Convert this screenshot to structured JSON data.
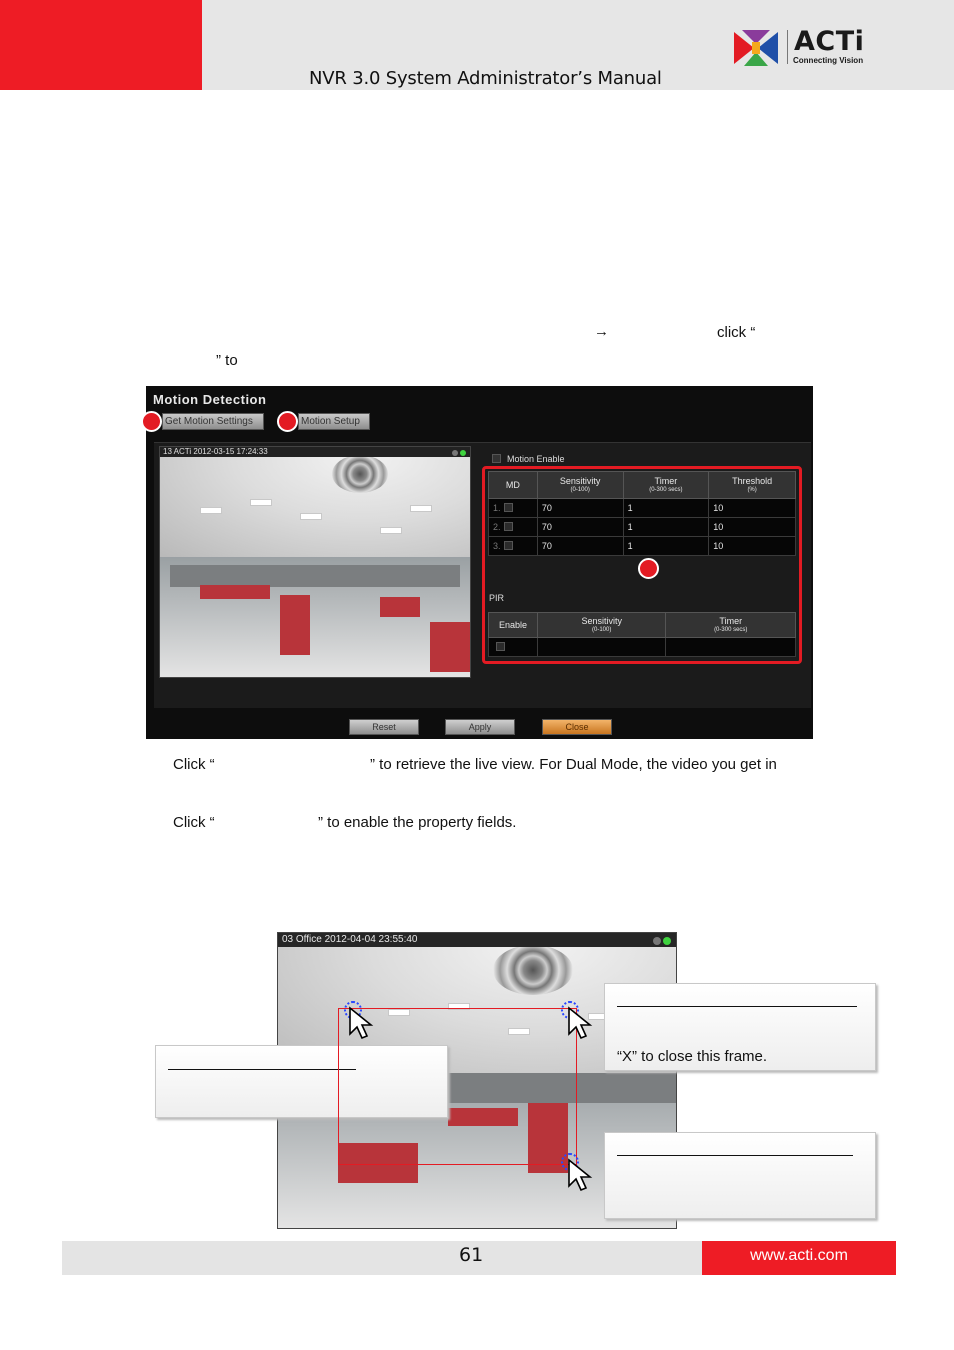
{
  "header": {
    "manual_title": "NVR 3.0 System Administrator’s Manual",
    "logo_word": "ACTi",
    "logo_tagline": "Connecting Vision"
  },
  "body": {
    "arrow_glyph": "",
    "click_fragment": "click “",
    "to_fragment": "” to",
    "step1_prefix": "Click “",
    "step1_suffix": "” to retrieve the live view. For Dual Mode, the video you get in",
    "step2_prefix": "Click “",
    "step2_suffix": "” to enable the property fields."
  },
  "motion_detection": {
    "title": "Motion Detection",
    "get_settings_label": "Get Motion Settings",
    "setup_label": "Motion Setup",
    "video_overlay": "13 ACTi  2012-03-15 17:24:33",
    "motion_enable_label": "Motion Enable",
    "md_table": {
      "headers": [
        {
          "label": "MD",
          "sub": ""
        },
        {
          "label": "Sensitivity",
          "sub": "(0-100)"
        },
        {
          "label": "Timer",
          "sub": "(0-300 secs)"
        },
        {
          "label": "Threshold",
          "sub": "(%)"
        }
      ],
      "rows": [
        {
          "index": "1.",
          "sensitivity": "70",
          "timer": "1",
          "threshold": "10"
        },
        {
          "index": "2.",
          "sensitivity": "70",
          "timer": "1",
          "threshold": "10"
        },
        {
          "index": "3.",
          "sensitivity": "70",
          "timer": "1",
          "threshold": "10"
        }
      ]
    },
    "pir_label": "PIR",
    "pir_table": {
      "headers": [
        {
          "label": "Enable",
          "sub": ""
        },
        {
          "label": "Sensitivity",
          "sub": "(0-100)"
        },
        {
          "label": "Timer",
          "sub": "(0-300 secs)"
        }
      ]
    },
    "reset_label": "Reset",
    "apply_label": "Apply",
    "close_label": "Close"
  },
  "motion_setup_view": {
    "video_overlay": "03 Office  2012-04-04 23:55:40",
    "callout_close_text": "“X” to close this frame."
  },
  "footer": {
    "page_number": "61",
    "website": "www.acti.com"
  },
  "colors": {
    "brand_red": "#ee1c25",
    "marker_red": "#e31b23",
    "handle_blue": "#2a48ff",
    "close_button_orange": "#e0953f"
  }
}
